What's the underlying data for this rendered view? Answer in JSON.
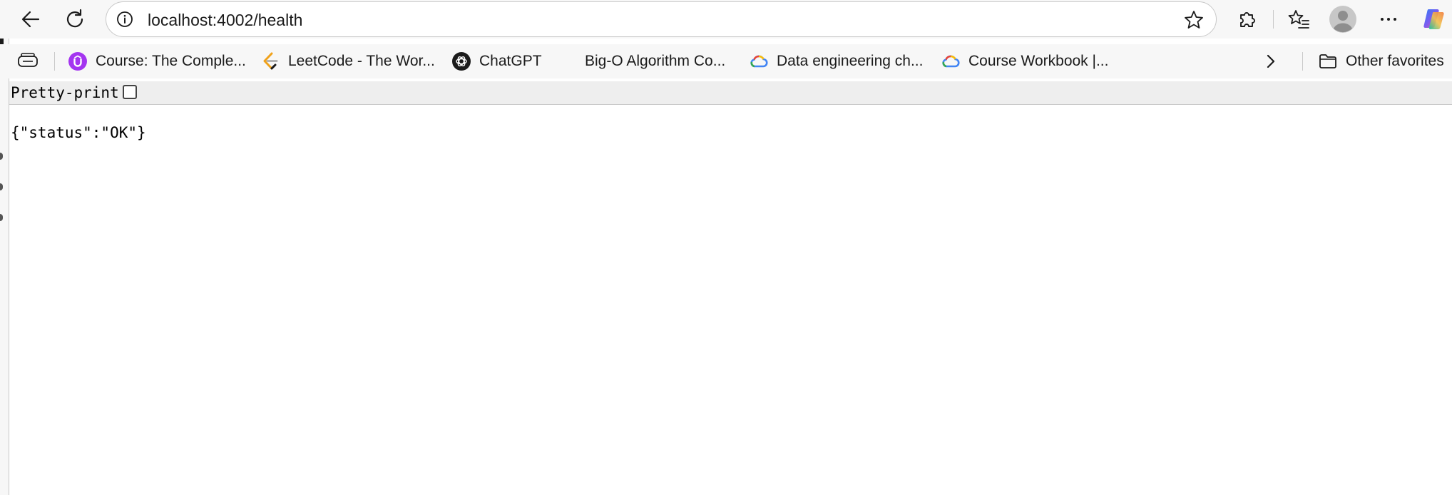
{
  "toolbar": {
    "url": "localhost:4002/health"
  },
  "favorites": {
    "items": [
      {
        "label": "Course: The Comple...",
        "icon": "udemy-icon"
      },
      {
        "label": "LeetCode - The Wor...",
        "icon": "leetcode-icon"
      },
      {
        "label": "ChatGPT",
        "icon": "chatgpt-icon"
      },
      {
        "label": "Big-O Algorithm Co...",
        "icon": ""
      },
      {
        "label": "Data engineering ch...",
        "icon": "google-cloud-icon"
      },
      {
        "label": "Course Workbook |...",
        "icon": "google-cloud-icon"
      }
    ],
    "other_label": "Other favorites"
  },
  "page": {
    "pretty_print_label": "Pretty-print",
    "pretty_print_checked": false,
    "json_text": "{\"status\":\"OK\"}"
  },
  "colors": {
    "chrome_bg": "#f7f7f7",
    "udemy_purple": "#a435f0",
    "text": "#1b1b1b"
  }
}
